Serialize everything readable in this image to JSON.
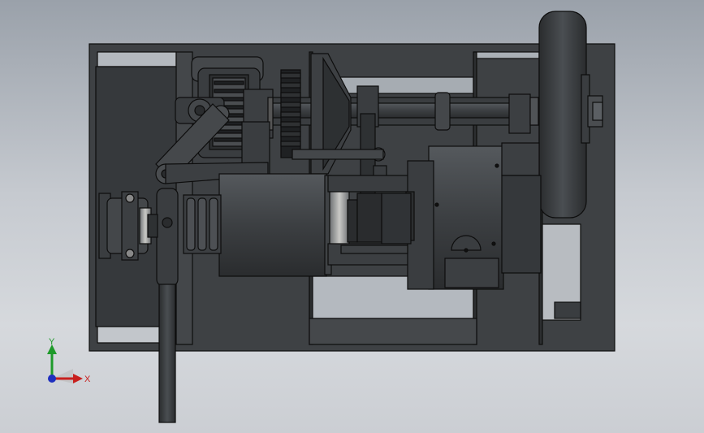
{
  "viewport": {
    "background_top": "#9aa1aa",
    "background_bottom": "#d6d9dd"
  },
  "model": {
    "body_color": "#3c3f42",
    "edge_color": "#0d0d0d",
    "highlight_color": "#5b5f63"
  },
  "triad": {
    "x_label": "X",
    "y_label": "Y",
    "x_color": "#c8201e",
    "y_color": "#1e9a2a",
    "z_color": "#1f2fbf"
  }
}
